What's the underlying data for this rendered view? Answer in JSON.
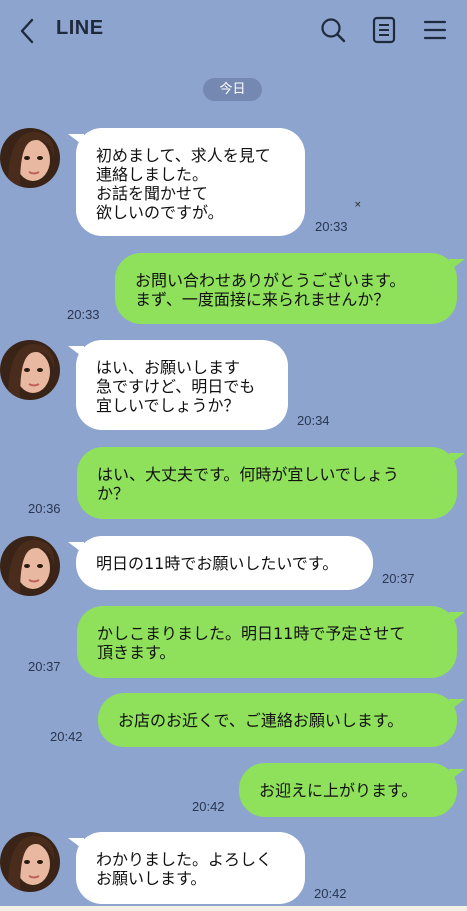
{
  "header": {
    "title": "LINE",
    "back_icon": "chevron-left-icon",
    "search_icon": "search-icon",
    "notes_icon": "notes-icon",
    "menu_icon": "hamburger-menu-icon"
  },
  "date_label": "今日",
  "stray_mark": "×",
  "colors": {
    "background": "#8da4cf",
    "sent_bubble": "#8fe05a",
    "received_bubble": "#ffffff",
    "date_pill": "#7488b1"
  },
  "messages": [
    {
      "sender": "other",
      "text": "初めまして、求人を見て\n連絡しました。\nお話を聞かせて\n欲しいのですが。",
      "time": "20:33"
    },
    {
      "sender": "me",
      "text": "お問い合わせありがとうございます。\nまず、一度面接に来られませんか？",
      "time": "20:33"
    },
    {
      "sender": "other",
      "text": "はい、お願いします\n急ですけど、明日でも\n宜しいでしょうか？",
      "time": "20:34"
    },
    {
      "sender": "me",
      "text": "はい、大丈夫です。何時が宜しいでしょう\nか？",
      "time": "20:36"
    },
    {
      "sender": "other",
      "text": "明日の11時でお願いしたいです。",
      "time": "20:37"
    },
    {
      "sender": "me",
      "text": "かしこまりました。明日11時で予定させて\n頂きます。",
      "time": "20:37"
    },
    {
      "sender": "me",
      "text": "お店のお近くで、ご連絡お願いします。",
      "time": "20:42"
    },
    {
      "sender": "me",
      "text": "お迎えに上がります。",
      "time": "20:42"
    },
    {
      "sender": "other",
      "text": "わかりました。よろしく\nお願いします。",
      "time": "20:42"
    }
  ]
}
